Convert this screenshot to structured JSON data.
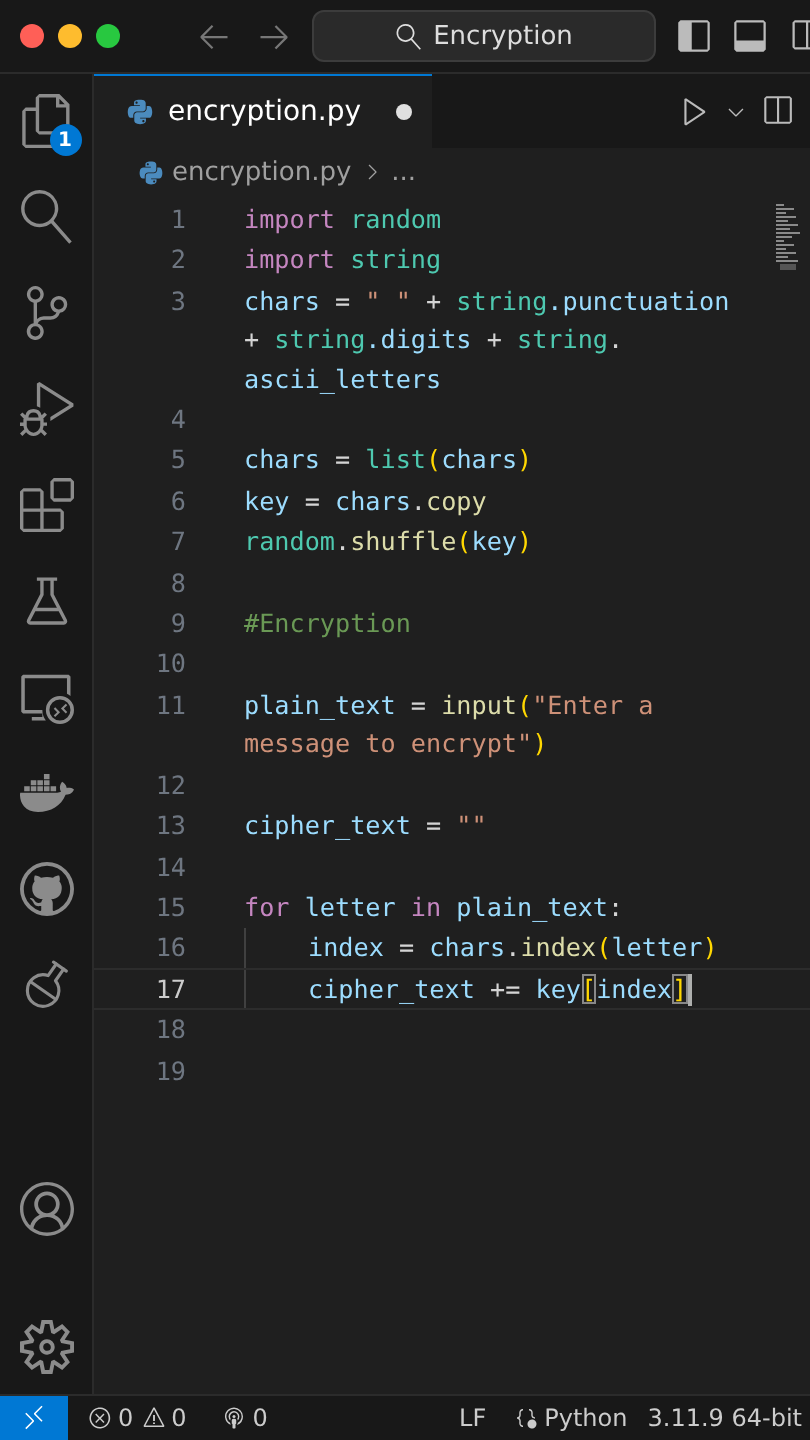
{
  "window": {
    "search": "Encryption"
  },
  "activity_bar": {
    "badge": "1"
  },
  "tabs": [
    {
      "label": "encryption.py",
      "selected": true,
      "modified": true
    }
  ],
  "breadcrumb": [
    "encryption.py",
    "..."
  ],
  "editor": {
    "lines": [
      {
        "number": "1",
        "active": false,
        "indented": false,
        "tokens": [
          {
            "kind": "keyword",
            "text": "import "
          },
          {
            "kind": "module",
            "text": "random"
          }
        ]
      },
      {
        "number": "2",
        "active": false,
        "indented": false,
        "tokens": [
          {
            "kind": "keyword",
            "text": "import "
          },
          {
            "kind": "module",
            "text": "string"
          }
        ]
      },
      {
        "number": "3",
        "active": false,
        "indented": false,
        "tokens": [
          {
            "kind": "variable",
            "text": "chars"
          },
          {
            "kind": "plain",
            "text": " = "
          },
          {
            "kind": "string",
            "text": "\" \""
          },
          {
            "kind": "plain",
            "text": " + "
          },
          {
            "kind": "module",
            "text": "string"
          },
          {
            "kind": "variable",
            "text": ".punctuation"
          },
          {
            "kind": "plain",
            "text": " + "
          },
          {
            "kind": "module",
            "text": "string"
          },
          {
            "kind": "variable",
            "text": ".digits"
          },
          {
            "kind": "plain",
            "text": " + "
          },
          {
            "kind": "module",
            "text": "string"
          },
          {
            "kind": "plain",
            "text": "."
          },
          {
            "kind": "variable",
            "text": "ascii_letters"
          }
        ]
      },
      {
        "number": "4",
        "active": false,
        "indented": false
      },
      {
        "number": "5",
        "active": false,
        "indented": false,
        "tokens": [
          {
            "kind": "variable",
            "text": "chars"
          },
          {
            "kind": "plain",
            "text": " = "
          },
          {
            "kind": "module",
            "text": "list"
          },
          {
            "kind": "bracket",
            "text": "("
          },
          {
            "kind": "variable",
            "text": "chars"
          },
          {
            "kind": "bracket",
            "text": ")"
          }
        ]
      },
      {
        "number": "6",
        "active": false,
        "indented": false,
        "tokens": [
          {
            "kind": "variable",
            "text": "key"
          },
          {
            "kind": "plain",
            "text": " = "
          },
          {
            "kind": "variable",
            "text": "chars"
          },
          {
            "kind": "plain",
            "text": "."
          },
          {
            "kind": "function",
            "text": "copy"
          }
        ]
      },
      {
        "number": "7",
        "active": false,
        "indented": false,
        "tokens": [
          {
            "kind": "module",
            "text": "random"
          },
          {
            "kind": "plain",
            "text": "."
          },
          {
            "kind": "function",
            "text": "shuffle"
          },
          {
            "kind": "bracket",
            "text": "("
          },
          {
            "kind": "variable",
            "text": "key"
          },
          {
            "kind": "bracket",
            "text": ")"
          }
        ]
      },
      {
        "number": "8",
        "active": false,
        "indented": false
      },
      {
        "number": "9",
        "active": false,
        "indented": false,
        "tokens": [
          {
            "kind": "comment",
            "text": "#Encryption"
          }
        ]
      },
      {
        "number": "10",
        "active": false,
        "indented": false
      },
      {
        "number": "11",
        "active": false,
        "indented": false,
        "tokens": [
          {
            "kind": "variable",
            "text": "plain_text"
          },
          {
            "kind": "plain",
            "text": " = "
          },
          {
            "kind": "function",
            "text": "input"
          },
          {
            "kind": "bracket",
            "text": "("
          },
          {
            "kind": "string",
            "text": "\"Enter a message to encrypt\""
          },
          {
            "kind": "bracket",
            "text": ")"
          }
        ]
      },
      {
        "number": "12",
        "active": false,
        "indented": false
      },
      {
        "number": "13",
        "active": false,
        "indented": false,
        "tokens": [
          {
            "kind": "variable",
            "text": "cipher_text"
          },
          {
            "kind": "plain",
            "text": " = "
          },
          {
            "kind": "string",
            "text": "\"\""
          }
        ]
      },
      {
        "number": "14",
        "active": false,
        "indented": false
      },
      {
        "number": "15",
        "active": false,
        "indented": false,
        "tokens": [
          {
            "kind": "keyword",
            "text": "for "
          },
          {
            "kind": "variable",
            "text": "letter "
          },
          {
            "kind": "keyword",
            "text": "in "
          },
          {
            "kind": "variable",
            "text": "plain_text"
          },
          {
            "kind": "plain",
            "text": ":"
          }
        ]
      },
      {
        "number": "16",
        "active": false,
        "indented": true,
        "tokens": [
          {
            "kind": "variable",
            "text": "index"
          },
          {
            "kind": "plain",
            "text": " = "
          },
          {
            "kind": "variable",
            "text": "chars"
          },
          {
            "kind": "plain",
            "text": "."
          },
          {
            "kind": "function",
            "text": "index"
          },
          {
            "kind": "bracket",
            "text": "("
          },
          {
            "kind": "variable",
            "text": "letter"
          },
          {
            "kind": "bracket",
            "text": ")"
          }
        ]
      },
      {
        "number": "17",
        "active": true,
        "indented": true,
        "tokens": [
          {
            "kind": "variable",
            "text": "cipher_text"
          },
          {
            "kind": "plain",
            "text": " += "
          },
          {
            "kind": "variable",
            "text": "key"
          },
          {
            "kind": "matched_bracket",
            "text": "["
          },
          {
            "kind": "variable",
            "text": "index"
          },
          {
            "kind": "matched_bracket",
            "text": "]"
          }
        ]
      },
      {
        "number": "18",
        "active": false,
        "indented": false
      },
      {
        "number": "19",
        "active": false,
        "indented": false
      }
    ]
  },
  "status_bar": {
    "errors": "0",
    "warnings": "0",
    "ports": "0",
    "line_ending": "LF",
    "language": "Python",
    "interpreter": "3.11.9 64-bit"
  }
}
